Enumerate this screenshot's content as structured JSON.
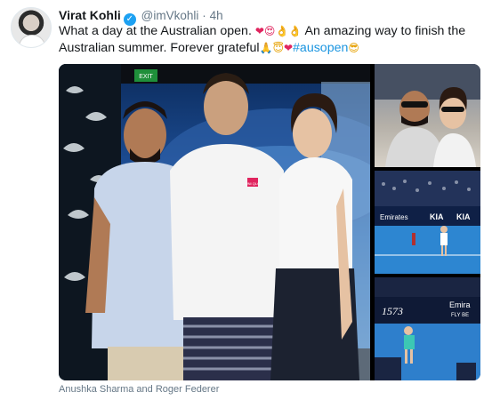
{
  "tweet": {
    "author_name": "Virat Kohli",
    "verified_glyph": "✓",
    "handle": "@imVkohli",
    "separator": "·",
    "time": "4h",
    "text_part1": "What a day at the Australian open.",
    "text_part2": "An amazing way to finish the Australian summer. Forever grateful",
    "hashtag": "#ausopen",
    "emojis": {
      "heart": "❤",
      "heart_eyes": "😍",
      "ok_hand": "👌",
      "folded_hands": "🙏",
      "halo_face": "😇",
      "sunglasses": "😎"
    }
  },
  "media": {
    "scoreboard_text": "Emirates",
    "ad_text_1": "KIA",
    "ad_text_2": "Emira",
    "ad_text_3": "FLY BE",
    "wall_text": "1573",
    "shirt_logo": "UNI QLO",
    "exit_sign": "EXIT"
  },
  "caption": "Anushka Sharma and Roger Federer",
  "colors": {
    "link": "#1b95e0",
    "verified": "#1da1f2",
    "muted": "#657786"
  }
}
